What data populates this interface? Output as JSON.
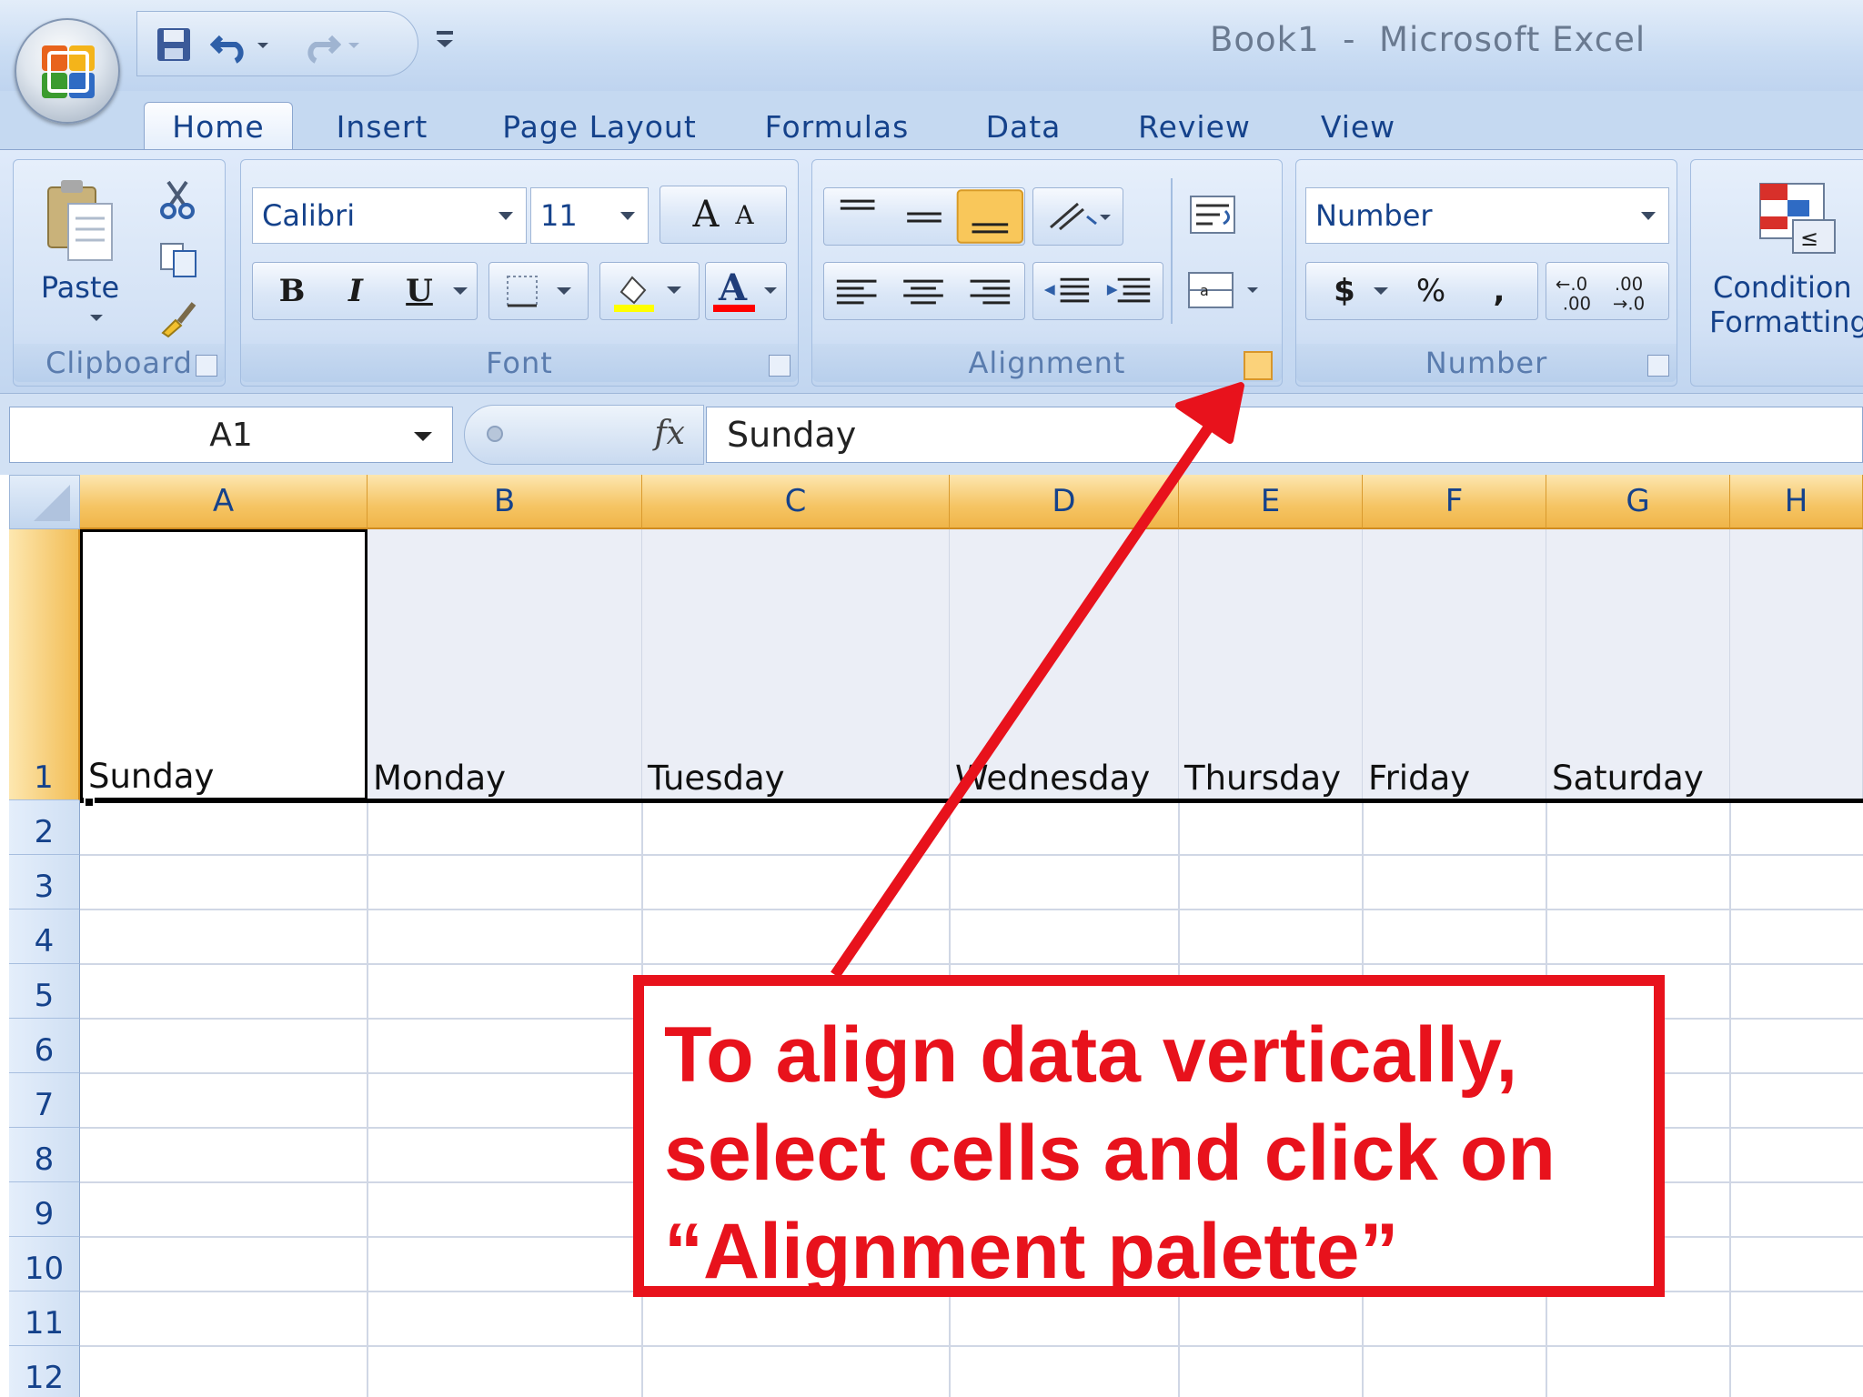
{
  "window": {
    "title": "Book1  -  Microsoft Excel"
  },
  "tabs": [
    {
      "label": "Home",
      "active": true
    },
    {
      "label": "Insert"
    },
    {
      "label": "Page Layout"
    },
    {
      "label": "Formulas"
    },
    {
      "label": "Data"
    },
    {
      "label": "Review"
    },
    {
      "label": "View"
    }
  ],
  "ribbon": {
    "clipboard": {
      "label": "Clipboard",
      "paste_label": "Paste"
    },
    "font": {
      "label": "Font",
      "font_name": "Calibri",
      "font_size": "11",
      "bold": "B",
      "italic": "I",
      "underline": "U",
      "grow": "A",
      "shrink": "A",
      "font_color": "A"
    },
    "alignment": {
      "label": "Alignment"
    },
    "number": {
      "label": "Number",
      "format": "Number",
      "currency": "$",
      "percent": "%",
      "comma": ","
    },
    "styles": {
      "conditional_formatting_line1": "Condition",
      "conditional_formatting_line2": "Formatting"
    }
  },
  "formula_bar": {
    "name_box": "A1",
    "fx": "fx",
    "value": "Sunday"
  },
  "columns": [
    "A",
    "B",
    "C",
    "D",
    "E",
    "F",
    "G",
    "H"
  ],
  "rows": [
    "1",
    "2",
    "3",
    "4",
    "5",
    "6",
    "7",
    "8",
    "9",
    "10",
    "11",
    "12"
  ],
  "row1_cells": [
    "Sunday",
    "Monday",
    "Tuesday",
    "Wednesday",
    "Thursday",
    "Friday",
    "Saturday",
    ""
  ],
  "annotation": {
    "text_line1": "To align data vertically,",
    "text_line2": "select cells and click on",
    "text_line3": "“Alignment palette”",
    "color": "#e8121c"
  },
  "colors": {
    "ribbon": "#cadcf3",
    "column_header_selected": "#f5c463",
    "tab_text": "#15428b"
  }
}
